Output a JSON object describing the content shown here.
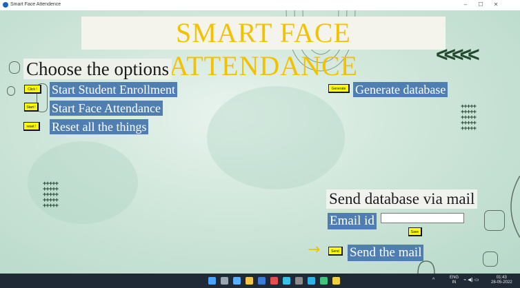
{
  "window": {
    "title": "Smart Face Attendence",
    "minimize": "–",
    "maximize": "☐",
    "close": "✕"
  },
  "app": {
    "title": "SMART  FACE  ATTENDANCE",
    "options_heading": "Choose the options",
    "chevrons": "<<<<<",
    "plus_grid": "+++++\n+++++\n+++++\n+++++\n+++++"
  },
  "actions": {
    "enroll": {
      "button": "Click !",
      "label": "Start Student Enrollment"
    },
    "attendance": {
      "button": "Start !",
      "label": "Start Face Attendance"
    },
    "reset": {
      "button": "reset !",
      "label": "Reset all the things"
    },
    "generate": {
      "button": "Generate",
      "label": "Generate database"
    }
  },
  "mail": {
    "heading": "Send database via mail",
    "email_label": "Email id",
    "email_value": "",
    "save_button": "Save",
    "send_button": "Send",
    "send_label": "Send the mail",
    "arrow": "→"
  },
  "taskbar": {
    "icons": [
      "start-icon",
      "search-icon",
      "task-view-icon",
      "file-explorer-icon",
      "store-icon",
      "calendar-icon",
      "photos-icon",
      "terminal-icon",
      "edge-icon",
      "app-icon",
      "python-icon"
    ],
    "icon_colors": [
      "#4aa3ff",
      "#9aa6b2",
      "#5ab0ff",
      "#f4c542",
      "#3b7dd8",
      "#e84c4c",
      "#37c2e8",
      "#8c8c8c",
      "#2fb4e9",
      "#41c37a",
      "#f2d13a"
    ],
    "tray_chevron": "^",
    "language": "ENG",
    "region": "IN",
    "tray_symbols": "⌁ ◀) ▭",
    "time": "01:43",
    "date": "28-05-2022"
  }
}
